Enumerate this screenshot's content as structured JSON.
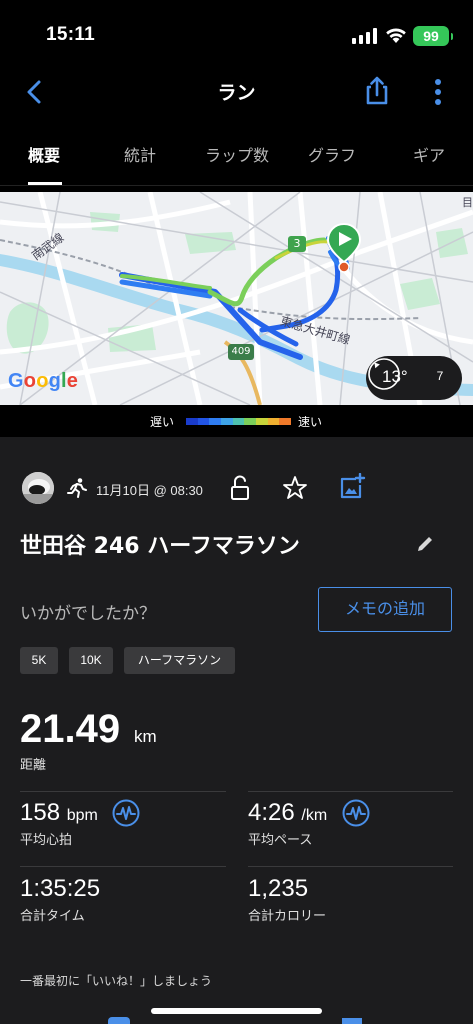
{
  "status_bar": {
    "time": "15:11",
    "battery": "99"
  },
  "header": {
    "title": "ラン"
  },
  "tabs": [
    {
      "label": "概要",
      "active": true
    },
    {
      "label": "統計"
    },
    {
      "label": "ラップ数"
    },
    {
      "label": "グラフ"
    },
    {
      "label": "ギア"
    }
  ],
  "map": {
    "attribution": "Google",
    "labels": {
      "line_west": "南武線",
      "line_east": "東急大井町線",
      "route_badge": "3",
      "road_badge": "409",
      "edge_char": "目"
    },
    "weather": {
      "temperature": "13°",
      "wind": "7"
    }
  },
  "speed_legend": {
    "slow_label": "遅い",
    "fast_label": "速い",
    "colors": [
      "#1a3ccc",
      "#2255e6",
      "#2f7df2",
      "#3ea3e8",
      "#4ec2b0",
      "#7bcf5a",
      "#c8d43a",
      "#f0b030",
      "#f07a2a"
    ]
  },
  "activity": {
    "date": "11月10日 @ 08:30",
    "title": "世田谷 246 ハーフマラソン",
    "feedback_prompt": "いかがでしたか？",
    "add_memo": "メモの追加",
    "tags": [
      "5K",
      "10K",
      "ハーフマラソン"
    ],
    "distance": {
      "value": "21.49",
      "unit": "km",
      "label": "距離"
    },
    "heart_rate": {
      "value": "158",
      "unit": "bpm",
      "label": "平均心拍"
    },
    "pace": {
      "value": "4:26",
      "unit": "/km",
      "label": "平均ペース"
    },
    "time": {
      "value": "1:35:25",
      "label": "合計タイム"
    },
    "calories": {
      "value": "1,235",
      "label": "合計カロリー"
    },
    "like_prompt": "一番最初に「いいね！」しましょう"
  },
  "colors": {
    "accent": "#4a8fe8",
    "background": "#1c1c1e",
    "start_marker": "#34a853"
  }
}
